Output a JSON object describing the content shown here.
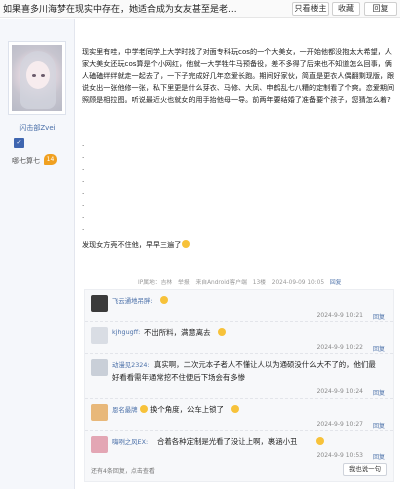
{
  "titlebar": {
    "title": "如果喜多川海梦在现实中存在，她适合成为女友甚至是老...",
    "only_lz": "只看楼主",
    "favorite": "收藏",
    "reply": "回复"
  },
  "user": {
    "name": "闪击部Zvei",
    "level_name": "哪七算七",
    "level_num": "14"
  },
  "post": {
    "paragraph": "现实里有哇，中学老同学上大学时找了对面专科玩cos的一个大美女，一开始他都没抱太大希望，人家大美女还玩cos算是个小网红，他就一大学牲牛马预备役，差不多得了后来也不知道怎么回事，俩人磕磕绊绊就走一起去了，一下子完成好几年恋爱长跑。期间好家伙，简直是更衣人偶翻剩现版，跟说女出一张他修一张，私下里更是什么芽衣、马修、大凤、申鹤乱七八糟的定制看了个爽。恋爱期间照顾是相拉图。听说最近火也就女的用手抬他母一导。前两年要结婚了准备要个孩子，您猜怎么着?",
    "closing": "发现女方壳不住他，早早三遍了"
  },
  "meta": {
    "ip": "IP属地：吉林",
    "report": "举报",
    "from": "来自Android客户端",
    "floor": "13楼",
    "time": "2024-09-09 10:05",
    "reply": "回复"
  },
  "comments": [
    {
      "name": "飞云通地吊胖:",
      "text": "",
      "time": "2024-9-9 10:21",
      "reply": "回复"
    },
    {
      "name": "kjhgugff:",
      "text": "不出所料，满意离去",
      "time": "2024-9-9 10:22",
      "reply": "回复"
    },
    {
      "name": "动漫见2324:",
      "text": "真实啊，二次元本子者人不懂让人以为通硕没什么大不了的，他们最",
      "text2": "好看看需年通常挖不住便后下场会有多惨",
      "time": "2024-9-9 10:24",
      "reply": "回复"
    },
    {
      "name": "恩名最牌",
      "text": "换个角度，公车上锁了",
      "time": "2024-9-9 10:27",
      "reply": "回复"
    },
    {
      "name": "嗨咧之风EX:",
      "text": "合着各种定制是光看了没让上啊，裹涵小丑",
      "time": "2024-9-9 10:53",
      "reply": "回复"
    }
  ],
  "comments_footer": {
    "more": "还有4条回复，点击查看",
    "button": "我也说一句"
  },
  "colors": {
    "link_blue": "#4a6fa8",
    "badge_orange": "#f0a020",
    "panel_bg": "#f5f7fb"
  }
}
